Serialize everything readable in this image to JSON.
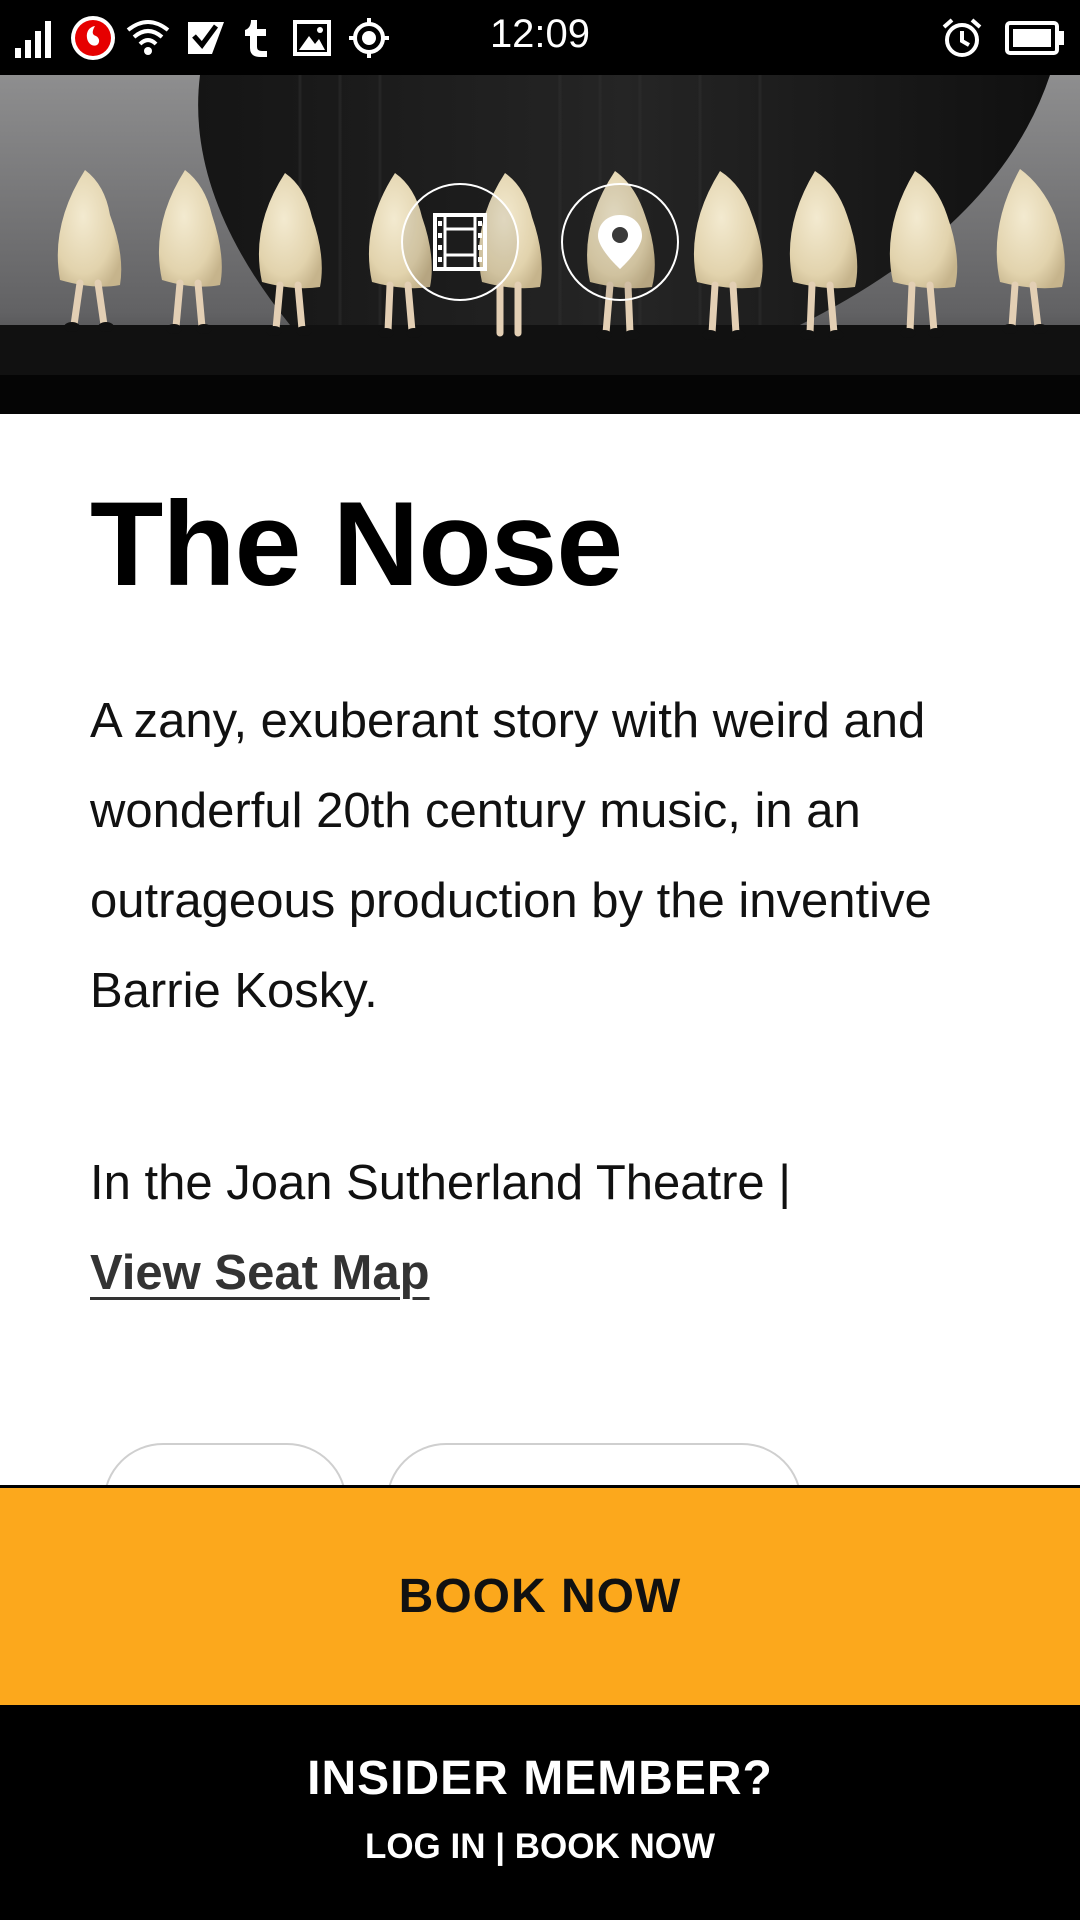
{
  "status_bar": {
    "time": "12:09",
    "icons": [
      "signal-icon",
      "vodafone-icon",
      "wifi-icon",
      "check-icon",
      "tumblr-icon",
      "image-icon",
      "target-icon",
      "alarm-icon",
      "battery-icon"
    ]
  },
  "hero": {
    "icons": [
      "film-icon",
      "location-pin-icon"
    ]
  },
  "event": {
    "title": "The Nose",
    "description": "A zany, exuberant story with weird and wonderful 20th century music, in an outrageous production by the inventive Barrie Kosky.",
    "venue_prefix": "In the Joan Sutherland Theatre |",
    "seat_map_link": "View Seat Map"
  },
  "book_bar": {
    "label": "BOOK NOW",
    "color": "#fca81c"
  },
  "insider": {
    "title": "INSIDER MEMBER?",
    "login_label": "LOG IN",
    "separator": "|",
    "book_label": "BOOK NOW"
  }
}
